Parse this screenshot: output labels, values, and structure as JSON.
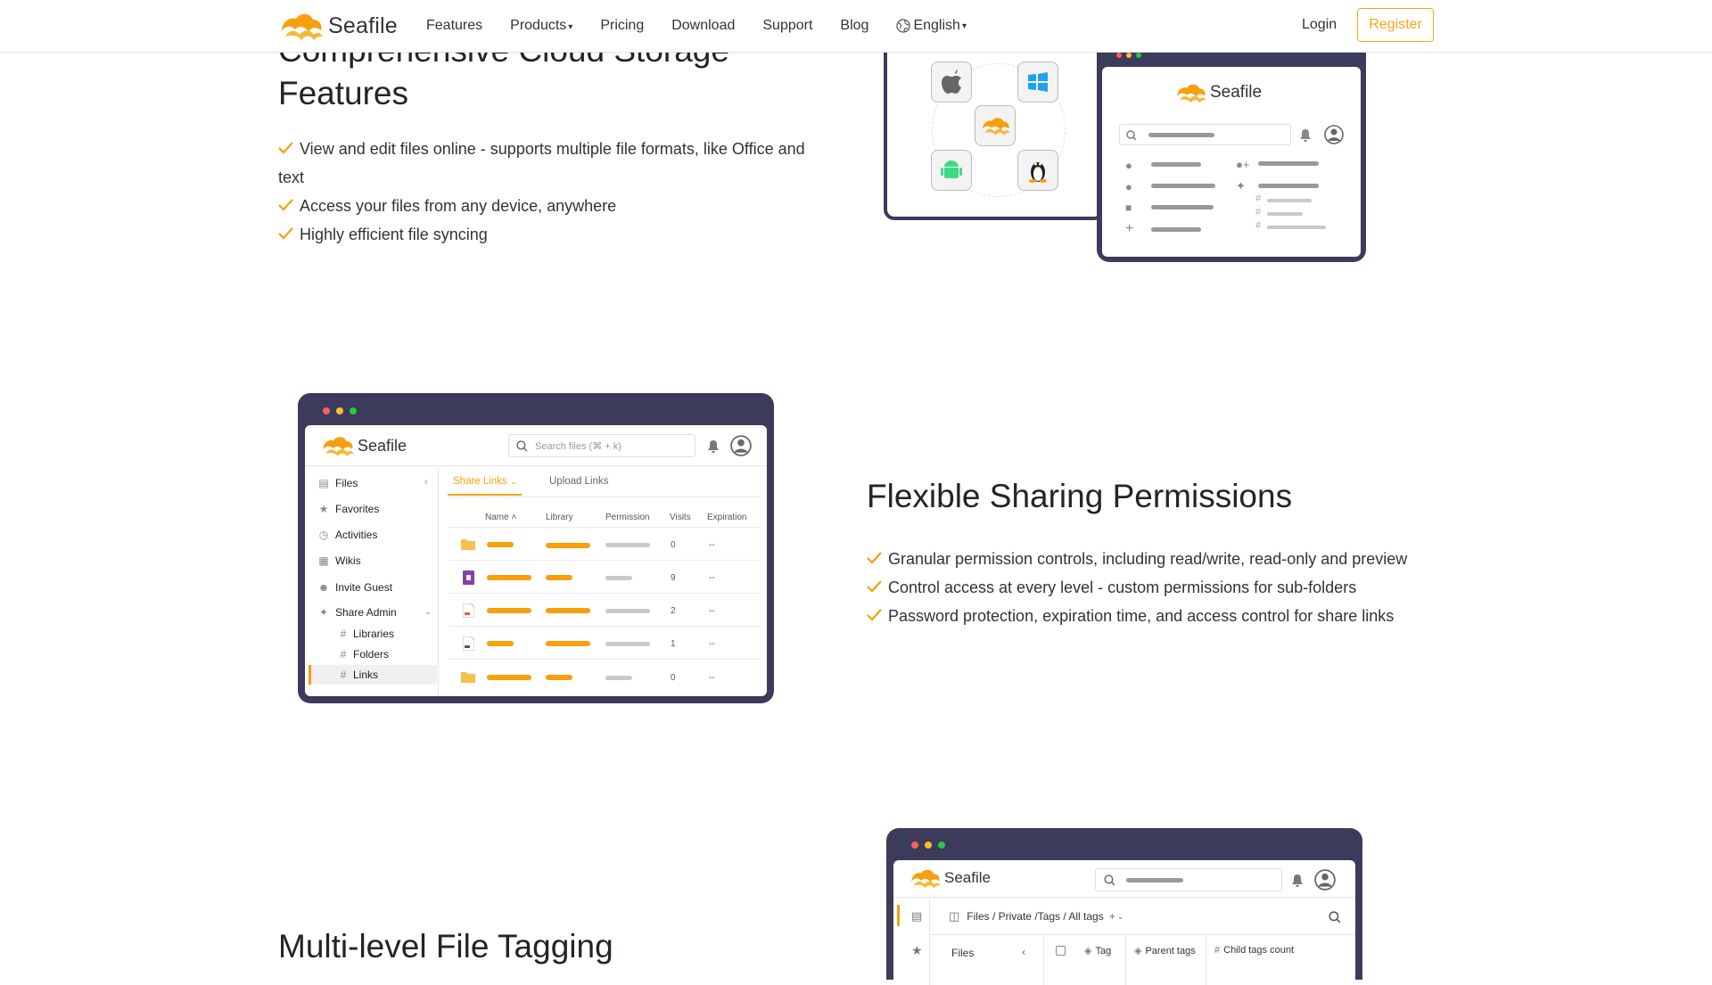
{
  "nav": {
    "brand": "Seafile",
    "links": [
      {
        "label": "Features"
      },
      {
        "label": "Products",
        "dropdown": true
      },
      {
        "label": "Pricing"
      },
      {
        "label": "Download"
      },
      {
        "label": "Support"
      },
      {
        "label": "Blog"
      },
      {
        "label": "English",
        "dropdown": true,
        "icon": "globe-icon"
      }
    ],
    "login": "Login",
    "register": "Register"
  },
  "section1": {
    "title_line1": "Comprehensive Cloud Storage",
    "title_line2": "Features",
    "bullets": [
      "View and edit files online - supports multiple file formats, like Office and",
      "text",
      "Access your files from any device, anywhere",
      "Highly efficient file syncing"
    ],
    "illustration": {
      "brand": "Seafile",
      "platform_icons": [
        "apple-icon",
        "windows-icon",
        "seafile-icon",
        "android-icon",
        "linux-icon"
      ]
    }
  },
  "section2": {
    "title": "Flexible Sharing Permissions",
    "bullets": [
      "Granular permission controls, including read/write, read-only and preview",
      "Control access at every level - custom permissions for sub-folders",
      "Password protection, expiration time, and access control for share links"
    ],
    "app": {
      "brand": "Seafile",
      "search_placeholder": "Search files (⌘ + k)",
      "sidebar": [
        "Files",
        "Favorites",
        "Activities",
        "Wikis",
        "Invite Guest",
        "Share Admin"
      ],
      "sub_items": [
        "Libraries",
        "Folders",
        "Links"
      ],
      "tabs": [
        "Share Links",
        "Upload Links"
      ],
      "columns": [
        "Name",
        "Library",
        "Permission",
        "Visits",
        "Expiration"
      ],
      "rows": [
        {
          "visits": "0",
          "expiration": "--"
        },
        {
          "visits": "9",
          "expiration": "--"
        },
        {
          "visits": "2",
          "expiration": "--"
        },
        {
          "visits": "1",
          "expiration": "--"
        },
        {
          "visits": "0",
          "expiration": "--"
        }
      ]
    }
  },
  "section3": {
    "title": "Multi-level File Tagging",
    "app": {
      "brand": "Seafile",
      "breadcrumb": "Files / Private /Tags / All tags",
      "side_label": "Files",
      "columns": [
        "Tag",
        "Parent tags",
        "Child tags count"
      ]
    }
  },
  "colors": {
    "accent": "#f7a614",
    "window": "#3c3b5b",
    "bar_orange": "#f5a00c"
  }
}
